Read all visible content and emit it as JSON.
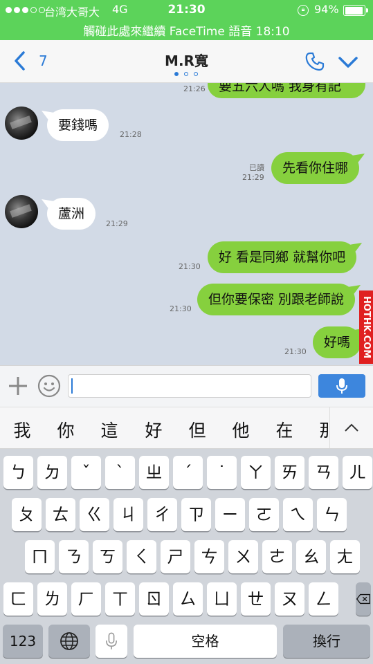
{
  "status_bar": {
    "carrier": "台湾大哥大",
    "network": "4G",
    "time": "21:30",
    "battery": "94%",
    "battery_level": 0.94,
    "facetime_banner": "觸碰此處來繼續 FaceTime 語音 18:10"
  },
  "nav": {
    "back_count": "7",
    "title": "M.R寬",
    "page_dots": 3,
    "active_page": 0,
    "back_icon": "chevron-left-icon",
    "call_icon": "phone-icon",
    "more_icon": "chevron-down-icon"
  },
  "messages": [
    {
      "side": "out",
      "text": "要五六人嗎 我身有記",
      "time": "21:26",
      "read": ""
    },
    {
      "side": "in",
      "text": "要錢嗎",
      "time": "21:28"
    },
    {
      "side": "out",
      "text": "先看你住哪",
      "time": "21:29",
      "read": "已讀"
    },
    {
      "side": "in",
      "text": "蘆洲",
      "time": "21:29"
    },
    {
      "side": "out",
      "text": "好 看是同鄉 就幫你吧",
      "time": "21:30",
      "read": ""
    },
    {
      "side": "out",
      "text": "但你要保密 別跟老師說",
      "time": "21:30",
      "read": ""
    },
    {
      "side": "out",
      "text": "好嗎",
      "time": "21:30",
      "read": ""
    }
  ],
  "watermark": "HOTHK.COM",
  "input": {
    "value": "",
    "plus_icon": "plus-icon",
    "emoji_icon": "emoji-icon",
    "mic_icon": "microphone-icon"
  },
  "candidates": [
    "我",
    "你",
    "這",
    "好",
    "但",
    "他",
    "在",
    "那"
  ],
  "keyboard": {
    "row1": [
      "ㄅ",
      "ㄉ",
      "ˇ",
      "ˋ",
      "ㄓ",
      "ˊ",
      "˙",
      "ㄚ",
      "ㄞ",
      "ㄢ",
      "ㄦ"
    ],
    "row2": [
      "ㄆ",
      "ㄊ",
      "ㄍ",
      "ㄐ",
      "ㄔ",
      "ㄗ",
      "ㄧ",
      "ㄛ",
      "ㄟ",
      "ㄣ"
    ],
    "row3": [
      "ㄇ",
      "ㄋ",
      "ㄎ",
      "ㄑ",
      "ㄕ",
      "ㄘ",
      "ㄨ",
      "ㄜ",
      "ㄠ",
      "ㄤ"
    ],
    "row4": [
      "ㄈ",
      "ㄌ",
      "ㄏ",
      "ㄒ",
      "ㄖ",
      "ㄙ",
      "ㄩ",
      "ㄝ",
      "ㄡ",
      "ㄥ"
    ],
    "numbers_label": "123",
    "space_label": "空格",
    "return_label": "換行",
    "globe_icon": "globe-icon",
    "mic_icon": "microphone-icon",
    "delete_icon": "backspace-icon"
  },
  "colors": {
    "status_bar": "#5cd35a",
    "accent": "#2a7ad6",
    "chat_bg": "#d2dae6",
    "outgoing_bubble": "#86d03e",
    "incoming_bubble": "#ffffff"
  }
}
